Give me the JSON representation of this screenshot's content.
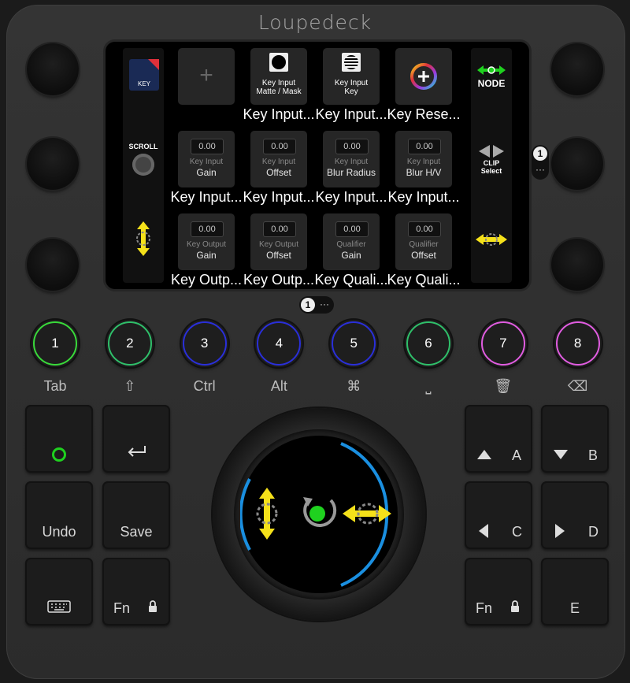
{
  "brand": "Loupedeck",
  "left_strip": {
    "key_label": "KEY",
    "scroll_label": "SCROLL"
  },
  "right_strip": {
    "node_label": "NODE",
    "clip_label": "CLIP",
    "select_label": "Select"
  },
  "tiles": [
    {
      "type": "add",
      "caption": ""
    },
    {
      "type": "icon",
      "line1": "Key Input",
      "line2": "Matte / Mask",
      "caption": "Key Input..."
    },
    {
      "type": "icon",
      "line1": "Key Input",
      "line2": "Key",
      "caption": "Key Input..."
    },
    {
      "type": "reset",
      "caption": "Key Rese..."
    },
    {
      "type": "value",
      "value": "0.00",
      "line1": "Key Input",
      "line2": "Gain",
      "caption": "Key Input..."
    },
    {
      "type": "value",
      "value": "0.00",
      "line1": "Key Input",
      "line2": "Offset",
      "caption": "Key Input..."
    },
    {
      "type": "value",
      "value": "0.00",
      "line1": "Key Input",
      "line2": "Blur Radius",
      "caption": "Key Input..."
    },
    {
      "type": "value",
      "value": "0.00",
      "line1": "Key Input",
      "line2": "Blur H/V",
      "caption": "Key Input..."
    },
    {
      "type": "value",
      "value": "0.00",
      "line1": "Key Output",
      "line2": "Gain",
      "caption": "Key Outp..."
    },
    {
      "type": "value",
      "value": "0.00",
      "line1": "Key Output",
      "line2": "Offset",
      "caption": "Key Outp..."
    },
    {
      "type": "value",
      "value": "0.00",
      "line1": "Qualifier",
      "line2": "Gain",
      "caption": "Key Quali..."
    },
    {
      "type": "value",
      "value": "0.00",
      "line1": "Qualifier",
      "line2": "Offset",
      "caption": "Key Quali..."
    }
  ],
  "page_indicator_screen": {
    "page": "1",
    "more": "···"
  },
  "page_indicator_right": {
    "page": "1",
    "more": "···"
  },
  "number_buttons": [
    {
      "n": "1",
      "label": "Tab",
      "color": "#39d93a"
    },
    {
      "n": "2",
      "label": "⇧",
      "color": "#2fbf6a"
    },
    {
      "n": "3",
      "label": "Ctrl",
      "color": "#2a2fd9"
    },
    {
      "n": "4",
      "label": "Alt",
      "color": "#2a2fd9"
    },
    {
      "n": "5",
      "label": "⌘",
      "color": "#2a2fd9"
    },
    {
      "n": "6",
      "label": "⎵",
      "color": "#2fbf6a"
    },
    {
      "n": "7",
      "label": "🗑",
      "color": "#e05ce0"
    },
    {
      "n": "8",
      "label": "⌫",
      "color": "#e05ce0"
    }
  ],
  "left_keys": {
    "undo": "Undo",
    "save": "Save",
    "fn": "Fn"
  },
  "right_keys": {
    "a": "A",
    "b": "B",
    "c": "C",
    "d": "D",
    "fn": "Fn",
    "e": "E"
  },
  "colors": {
    "accent_green": "#1fd11f",
    "arrow_yellow": "#f5e11a",
    "wheel_blue": "#1a8fe0"
  }
}
